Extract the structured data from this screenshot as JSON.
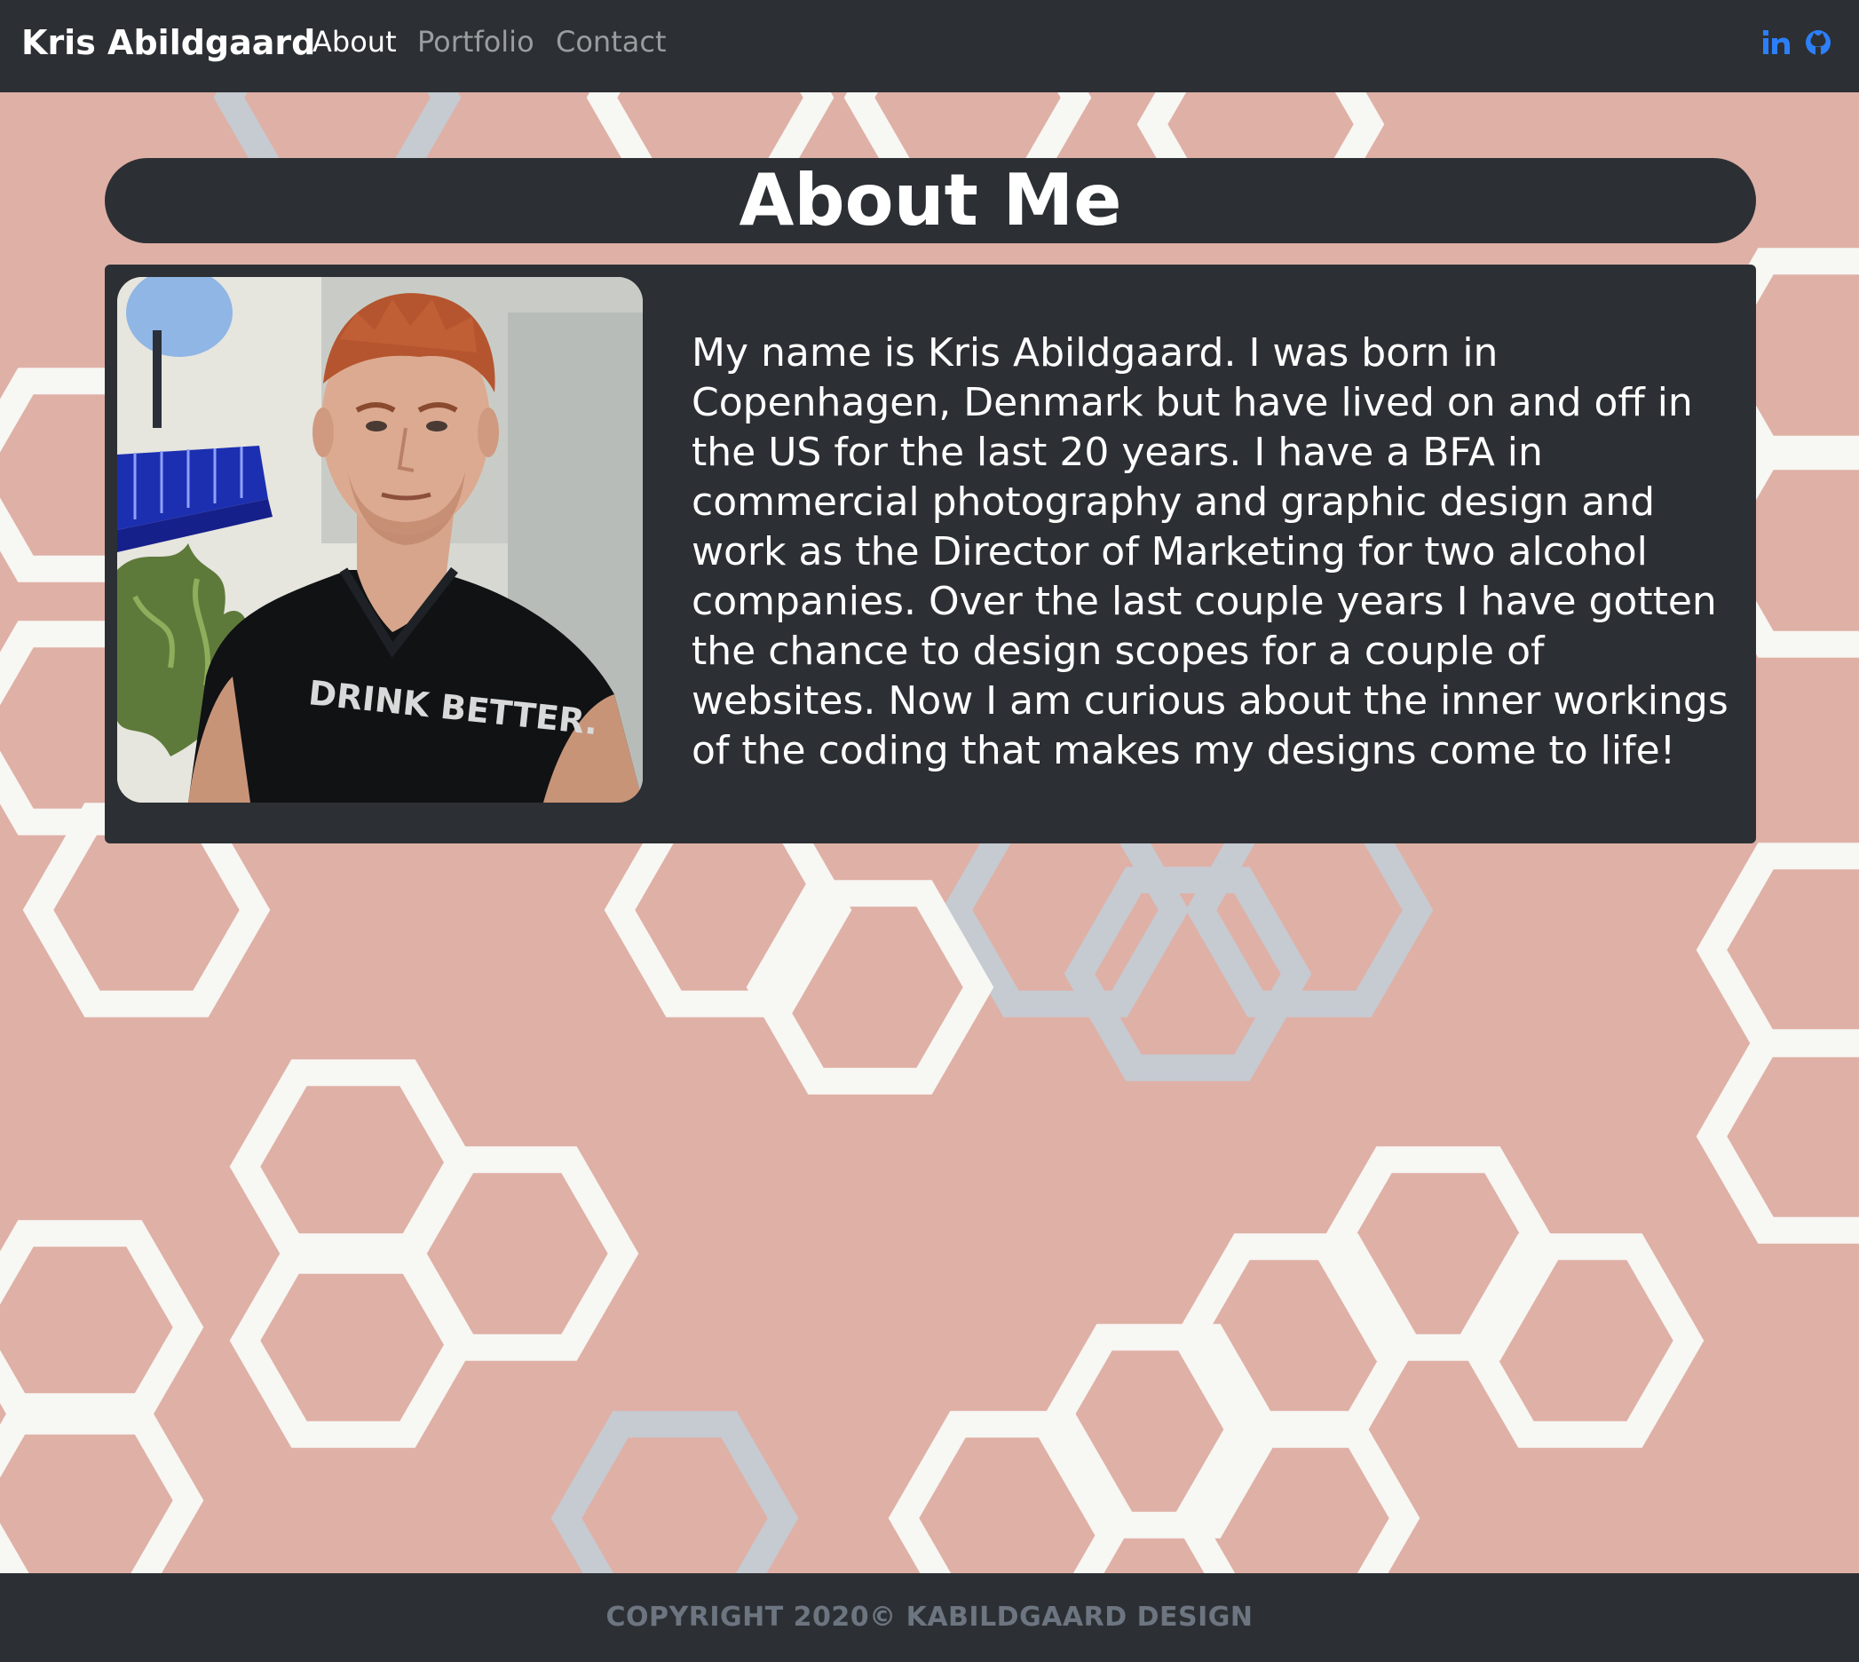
{
  "navbar": {
    "brand": "Kris Abildgaard",
    "links": [
      {
        "label": "About",
        "active": true
      },
      {
        "label": "Portfolio",
        "active": false
      },
      {
        "label": "Contact",
        "active": false
      }
    ],
    "social": [
      {
        "icon": "linkedin-icon"
      },
      {
        "icon": "github-icon"
      }
    ]
  },
  "about": {
    "title": "About Me",
    "photo_shirt_text": "DRINK BETTER.",
    "bio": "My name is Kris Abildgaard. I was born in Copenhagen, Denmark but have lived on and off in the US for the last 20 years. I have a BFA in commercial photography and graphic design and work as the Director of Marketing for two alcohol companies. Over the last couple years I have gotten the chance to design scopes for a couple of websites. Now I am curious about the inner workings of the coding that makes my designs come to life!"
  },
  "footer": {
    "text": "COPYRIGHT 2020© KABILDGAARD DESIGN"
  },
  "colors": {
    "background": "#dfb0a6",
    "dark": "#2c3034",
    "hex_white": "#f7f7f3",
    "hex_gray": "#c6cad1",
    "social_blue": "#2d7ff9",
    "footer_text": "#6c7580"
  }
}
